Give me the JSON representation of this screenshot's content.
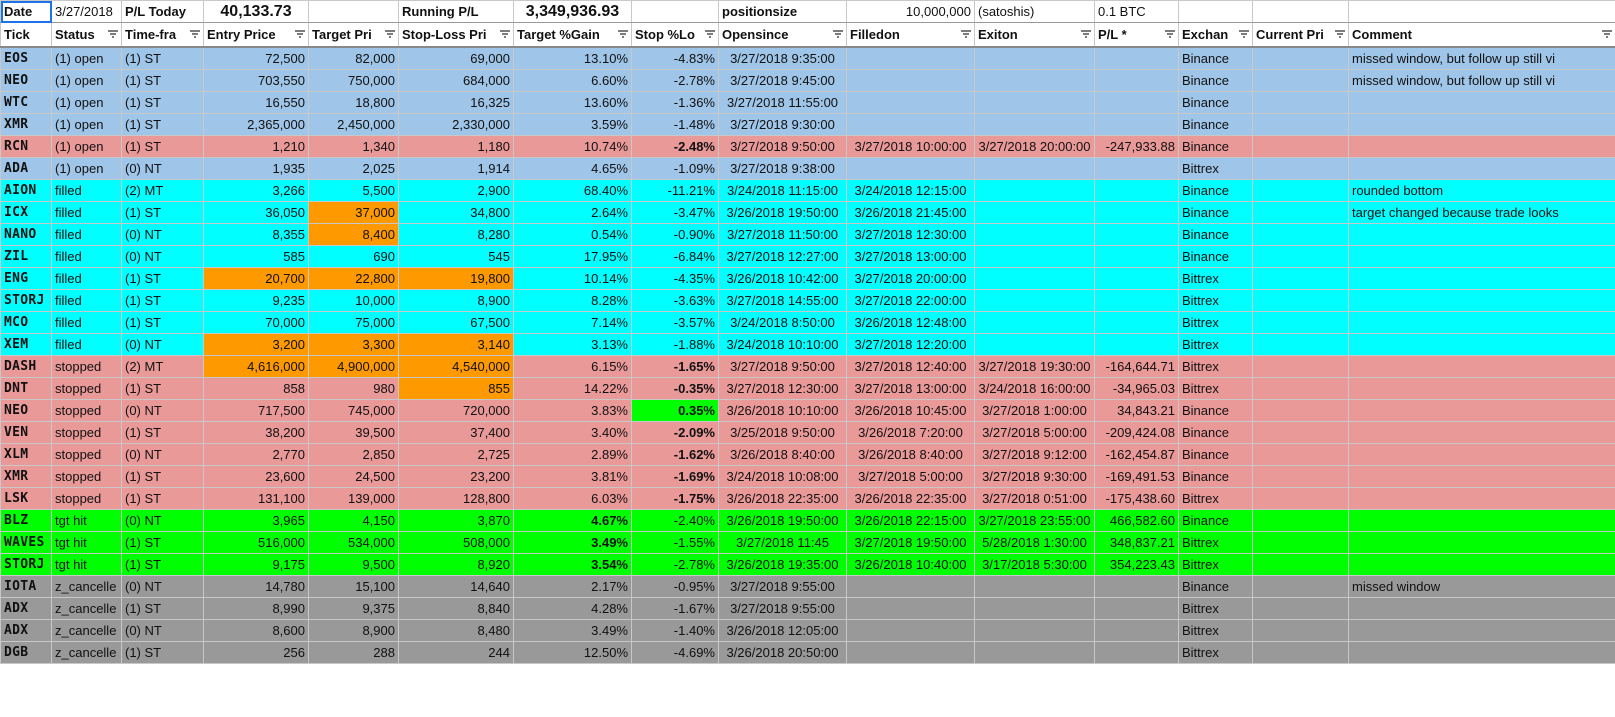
{
  "top": {
    "date_label": "Date",
    "date_value": "3/27/2018",
    "pl_today_label": "P/L Today",
    "pl_today_value": "40,133.73",
    "running_label": "Running P/L",
    "running_value": "3,349,936.93",
    "positionsize_label": "positionsize",
    "positionsize_value": "10,000,000",
    "unit_label": "(satoshis)",
    "btc_label": "0.1 BTC"
  },
  "headers": [
    "Tick",
    "Status",
    "Time-fra",
    "Entry Price",
    "Target Pri",
    "Stop-Loss Pri",
    "Target %Gain",
    "Stop %Lo",
    "Opensince",
    "Filledon",
    "Exiton",
    "P/L *",
    "Exchan",
    "Current Pri",
    "Comment"
  ],
  "colors": {
    "open": "#9fc5e8",
    "filled": "#00ffff",
    "stopped": "#ea9999",
    "tgt": "#00ff00",
    "cancelled": "#999999",
    "orange": "#ff9900",
    "green_cell": "#00ff00",
    "white": "#ffffff"
  },
  "rows": [
    {
      "tick": "EOS",
      "status": "(1) open",
      "tf": "(1) ST",
      "entry": "72,500",
      "target": "82,000",
      "stop": "69,000",
      "gain": "13.10%",
      "loss": "-4.83%",
      "open": "3/27/2018 9:35:00",
      "filled": "",
      "exit": "",
      "pl": "",
      "exch": "Binance",
      "cur": "",
      "comment": "missed window, but follow up still vi",
      "bg": "open"
    },
    {
      "tick": "NEO",
      "status": "(1) open",
      "tf": "(1) ST",
      "entry": "703,550",
      "target": "750,000",
      "stop": "684,000",
      "gain": "6.60%",
      "loss": "-2.78%",
      "open": "3/27/2018 9:45:00",
      "filled": "",
      "exit": "",
      "pl": "",
      "exch": "Binance",
      "cur": "",
      "comment": "missed window, but follow up still vi",
      "bg": "open"
    },
    {
      "tick": "WTC",
      "status": "(1) open",
      "tf": "(1) ST",
      "entry": "16,550",
      "target": "18,800",
      "stop": "16,325",
      "gain": "13.60%",
      "loss": "-1.36%",
      "open": "3/27/2018 11:55:00",
      "filled": "",
      "exit": "",
      "pl": "",
      "exch": "Binance",
      "cur": "",
      "comment": "",
      "bg": "open"
    },
    {
      "tick": "XMR",
      "status": "(1) open",
      "tf": "(1) ST",
      "entry": "2,365,000",
      "target": "2,450,000",
      "stop": "2,330,000",
      "gain": "3.59%",
      "loss": "-1.48%",
      "open": "3/27/2018 9:30:00",
      "filled": "",
      "exit": "",
      "pl": "",
      "exch": "Binance",
      "cur": "",
      "comment": "",
      "bg": "open"
    },
    {
      "tick": "RCN",
      "status": "(1) open",
      "tf": "(1) ST",
      "entry": "1,210",
      "target": "1,340",
      "stop": "1,180",
      "gain": "10.74%",
      "loss": "-2.48%",
      "open": "3/27/2018 9:50:00",
      "filled": "3/27/2018 10:00:00",
      "exit": "3/27/2018 20:00:00",
      "pl": "-247,933.88",
      "exch": "Binance",
      "cur": "",
      "comment": "",
      "bg": "stopped",
      "lossBold": true
    },
    {
      "tick": "ADA",
      "status": "(1) open",
      "tf": "(0) NT",
      "entry": "1,935",
      "target": "2,025",
      "stop": "1,914",
      "gain": "4.65%",
      "loss": "-1.09%",
      "open": "3/27/2018 9:38:00",
      "filled": "",
      "exit": "",
      "pl": "",
      "exch": "Bittrex",
      "cur": "",
      "comment": "",
      "bg": "open"
    },
    {
      "tick": "AION",
      "status": "filled",
      "tf": "(2) MT",
      "entry": "3,266",
      "target": "5,500",
      "stop": "2,900",
      "gain": "68.40%",
      "loss": "-11.21%",
      "open": "3/24/2018 11:15:00",
      "filled": "3/24/2018 12:15:00",
      "exit": "",
      "pl": "",
      "exch": "Binance",
      "cur": "",
      "comment": "rounded bottom",
      "bg": "filled"
    },
    {
      "tick": "ICX",
      "status": "filled",
      "tf": "(1) ST",
      "entry": "36,050",
      "target": "37,000",
      "stop": "34,800",
      "gain": "2.64%",
      "loss": "-3.47%",
      "open": "3/26/2018 19:50:00",
      "filled": "3/26/2018 21:45:00",
      "exit": "",
      "pl": "",
      "exch": "Binance",
      "cur": "",
      "comment": "target changed because trade looks",
      "bg": "filled",
      "targetOrange": true
    },
    {
      "tick": "NANO",
      "status": "filled",
      "tf": "(0) NT",
      "entry": "8,355",
      "target": "8,400",
      "stop": "8,280",
      "gain": "0.54%",
      "loss": "-0.90%",
      "open": "3/27/2018 11:50:00",
      "filled": "3/27/2018 12:30:00",
      "exit": "",
      "pl": "",
      "exch": "Binance",
      "cur": "",
      "comment": "",
      "bg": "filled",
      "targetOrange": true
    },
    {
      "tick": "ZIL",
      "status": "filled",
      "tf": "(0) NT",
      "entry": "585",
      "target": "690",
      "stop": "545",
      "gain": "17.95%",
      "loss": "-6.84%",
      "open": "3/27/2018 12:27:00",
      "filled": "3/27/2018 13:00:00",
      "exit": "",
      "pl": "",
      "exch": "Binance",
      "cur": "",
      "comment": "",
      "bg": "filled"
    },
    {
      "tick": "ENG",
      "status": "filled",
      "tf": "(1) ST",
      "entry": "20,700",
      "target": "22,800",
      "stop": "19,800",
      "gain": "10.14%",
      "loss": "-4.35%",
      "open": "3/26/2018 10:42:00",
      "filled": "3/27/2018 20:00:00",
      "exit": "",
      "pl": "",
      "exch": "Bittrex",
      "cur": "",
      "comment": "",
      "bg": "filled",
      "entryOrange": true,
      "targetOrange": true,
      "stopOrange": true
    },
    {
      "tick": "STORJ",
      "status": "filled",
      "tf": "(1) ST",
      "entry": "9,235",
      "target": "10,000",
      "stop": "8,900",
      "gain": "8.28%",
      "loss": "-3.63%",
      "open": "3/27/2018 14:55:00",
      "filled": "3/27/2018 22:00:00",
      "exit": "",
      "pl": "",
      "exch": "Bittrex",
      "cur": "",
      "comment": "",
      "bg": "filled"
    },
    {
      "tick": "MCO",
      "status": "filled",
      "tf": "(1) ST",
      "entry": "70,000",
      "target": "75,000",
      "stop": "67,500",
      "gain": "7.14%",
      "loss": "-3.57%",
      "open": "3/24/2018 8:50:00",
      "filled": "3/26/2018 12:48:00",
      "exit": "",
      "pl": "",
      "exch": "Bittrex",
      "cur": "",
      "comment": "",
      "bg": "filled"
    },
    {
      "tick": "XEM",
      "status": "filled",
      "tf": "(0) NT",
      "entry": "3,200",
      "target": "3,300",
      "stop": "3,140",
      "gain": "3.13%",
      "loss": "-1.88%",
      "open": "3/24/2018 10:10:00",
      "filled": "3/27/2018 12:20:00",
      "exit": "",
      "pl": "",
      "exch": "Bittrex",
      "cur": "",
      "comment": "",
      "bg": "filled",
      "entryOrange": true,
      "targetOrange": true,
      "stopOrange": true
    },
    {
      "tick": "DASH",
      "status": "stopped",
      "tf": "(2) MT",
      "entry": "4,616,000",
      "target": "4,900,000",
      "stop": "4,540,000",
      "gain": "6.15%",
      "loss": "-1.65%",
      "open": "3/27/2018 9:50:00",
      "filled": "3/27/2018 12:40:00",
      "exit": "3/27/2018 19:30:00",
      "pl": "-164,644.71",
      "exch": "Bittrex",
      "cur": "",
      "comment": "",
      "bg": "stopped",
      "entryOrange": true,
      "targetOrange": true,
      "stopOrange": true,
      "lossBold": true
    },
    {
      "tick": "DNT",
      "status": "stopped",
      "tf": "(1) ST",
      "entry": "858",
      "target": "980",
      "stop": "855",
      "gain": "14.22%",
      "loss": "-0.35%",
      "open": "3/27/2018 12:30:00",
      "filled": "3/27/2018 13:00:00",
      "exit": "3/24/2018 16:00:00",
      "pl": "-34,965.03",
      "exch": "Bittrex",
      "cur": "",
      "comment": "",
      "bg": "stopped",
      "stopOrange": true,
      "lossBold": true
    },
    {
      "tick": "NEO",
      "status": "stopped",
      "tf": "(0) NT",
      "entry": "717,500",
      "target": "745,000",
      "stop": "720,000",
      "gain": "3.83%",
      "loss": "0.35%",
      "open": "3/26/2018 10:10:00",
      "filled": "3/26/2018 10:45:00",
      "exit": "3/27/2018 1:00:00",
      "pl": "34,843.21",
      "exch": "Binance",
      "cur": "",
      "comment": "",
      "bg": "stopped",
      "lossGreen": true,
      "lossBold": true
    },
    {
      "tick": "VEN",
      "status": "stopped",
      "tf": "(1) ST",
      "entry": "38,200",
      "target": "39,500",
      "stop": "37,400",
      "gain": "3.40%",
      "loss": "-2.09%",
      "open": "3/25/2018 9:50:00",
      "filled": "3/26/2018 7:20:00",
      "exit": "3/27/2018 5:00:00",
      "pl": "-209,424.08",
      "exch": "Binance",
      "cur": "",
      "comment": "",
      "bg": "stopped",
      "lossBold": true
    },
    {
      "tick": "XLM",
      "status": "stopped",
      "tf": "(0) NT",
      "entry": "2,770",
      "target": "2,850",
      "stop": "2,725",
      "gain": "2.89%",
      "loss": "-1.62%",
      "open": "3/26/2018 8:40:00",
      "filled": "3/26/2018 8:40:00",
      "exit": "3/27/2018 9:12:00",
      "pl": "-162,454.87",
      "exch": "Binance",
      "cur": "",
      "comment": "",
      "bg": "stopped",
      "lossBold": true
    },
    {
      "tick": "XMR",
      "status": "stopped",
      "tf": "(1) ST",
      "entry": "23,600",
      "target": "24,500",
      "stop": "23,200",
      "gain": "3.81%",
      "loss": "-1.69%",
      "open": "3/24/2018 10:08:00",
      "filled": "3/27/2018 5:00:00",
      "exit": "3/27/2018 9:30:00",
      "pl": "-169,491.53",
      "exch": "Binance",
      "cur": "",
      "comment": "",
      "bg": "stopped",
      "lossBold": true
    },
    {
      "tick": "LSK",
      "status": "stopped",
      "tf": "(1) ST",
      "entry": "131,100",
      "target": "139,000",
      "stop": "128,800",
      "gain": "6.03%",
      "loss": "-1.75%",
      "open": "3/26/2018 22:35:00",
      "filled": "3/26/2018 22:35:00",
      "exit": "3/27/2018 0:51:00",
      "pl": "-175,438.60",
      "exch": "Bittrex",
      "cur": "",
      "comment": "",
      "bg": "stopped",
      "lossBold": true
    },
    {
      "tick": "BLZ",
      "status": "tgt hit",
      "tf": "(0) NT",
      "entry": "3,965",
      "target": "4,150",
      "stop": "3,870",
      "gain": "4.67%",
      "loss": "-2.40%",
      "open": "3/26/2018 19:50:00",
      "filled": "3/26/2018 22:15:00",
      "exit": "3/27/2018 23:55:00",
      "pl": "466,582.60",
      "exch": "Binance",
      "cur": "",
      "comment": "",
      "bg": "tgt",
      "gainBold": true
    },
    {
      "tick": "WAVES",
      "status": "tgt hit",
      "tf": "(1) ST",
      "entry": "516,000",
      "target": "534,000",
      "stop": "508,000",
      "gain": "3.49%",
      "loss": "-1.55%",
      "open": "3/27/2018 11:45",
      "filled": "3/27/2018 19:50:00",
      "exit": "5/28/2018 1:30:00",
      "pl": "348,837.21",
      "exch": "Bittrex",
      "cur": "",
      "comment": "",
      "bg": "tgt",
      "gainBold": true
    },
    {
      "tick": "STORJ",
      "status": "tgt hit",
      "tf": "(1) ST",
      "entry": "9,175",
      "target": "9,500",
      "stop": "8,920",
      "gain": "3.54%",
      "loss": "-2.78%",
      "open": "3/26/2018 19:35:00",
      "filled": "3/26/2018 10:40:00",
      "exit": "3/17/2018 5:30:00",
      "pl": "354,223.43",
      "exch": "Bittrex",
      "cur": "",
      "comment": "",
      "bg": "tgt",
      "gainBold": true
    },
    {
      "tick": "IOTA",
      "status": "z_cancelle",
      "tf": "(0) NT",
      "entry": "14,780",
      "target": "15,100",
      "stop": "14,640",
      "gain": "2.17%",
      "loss": "-0.95%",
      "open": "3/27/2018 9:55:00",
      "filled": "",
      "exit": "",
      "pl": "",
      "exch": "Binance",
      "cur": "",
      "comment": "missed window",
      "bg": "cancelled"
    },
    {
      "tick": "ADX",
      "status": "z_cancelle",
      "tf": "(1) ST",
      "entry": "8,990",
      "target": "9,375",
      "stop": "8,840",
      "gain": "4.28%",
      "loss": "-1.67%",
      "open": "3/27/2018 9:55:00",
      "filled": "",
      "exit": "",
      "pl": "",
      "exch": "Bittrex",
      "cur": "",
      "comment": "",
      "bg": "cancelled"
    },
    {
      "tick": "ADX",
      "status": "z_cancelle",
      "tf": "(0) NT",
      "entry": "8,600",
      "target": "8,900",
      "stop": "8,480",
      "gain": "3.49%",
      "loss": "-1.40%",
      "open": "3/26/2018 12:05:00",
      "filled": "",
      "exit": "",
      "pl": "",
      "exch": "Bittrex",
      "cur": "",
      "comment": "",
      "bg": "cancelled"
    },
    {
      "tick": "DGB",
      "status": "z_cancelle",
      "tf": "(1) ST",
      "entry": "256",
      "target": "288",
      "stop": "244",
      "gain": "12.50%",
      "loss": "-4.69%",
      "open": "3/26/2018 20:50:00",
      "filled": "",
      "exit": "",
      "pl": "",
      "exch": "Bittrex",
      "cur": "",
      "comment": "",
      "bg": "cancelled"
    }
  ]
}
